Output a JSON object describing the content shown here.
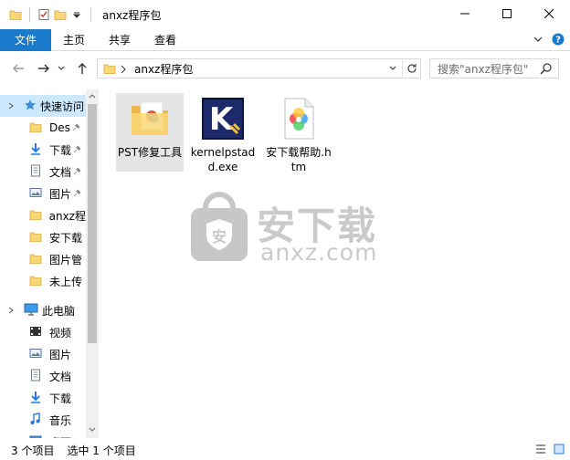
{
  "window": {
    "title": "anxz程序包"
  },
  "ribbon": {
    "tabs": [
      {
        "label": "文件"
      },
      {
        "label": "主页"
      },
      {
        "label": "共享"
      },
      {
        "label": "查看"
      }
    ]
  },
  "address": {
    "path": "anxz程序包",
    "search_placeholder": "搜索\"anxz程序包\""
  },
  "nav": {
    "quick_access": "快速访问",
    "items": [
      {
        "label": "Des",
        "icon": "folder-icon",
        "pinned": true
      },
      {
        "label": "下载",
        "icon": "download-icon",
        "pinned": true
      },
      {
        "label": "文档",
        "icon": "document-icon",
        "pinned": true
      },
      {
        "label": "图片",
        "icon": "picture-icon",
        "pinned": true
      },
      {
        "label": "anxz程",
        "icon": "folder-icon",
        "pinned": false
      },
      {
        "label": "安下载",
        "icon": "folder-icon",
        "pinned": false
      },
      {
        "label": "图片管",
        "icon": "folder-icon",
        "pinned": false
      },
      {
        "label": "未上传",
        "icon": "folder-icon",
        "pinned": false
      }
    ],
    "this_pc": "此电脑",
    "pc_items": [
      {
        "label": "视频",
        "icon": "video-icon"
      },
      {
        "label": "图片",
        "icon": "picture-icon"
      },
      {
        "label": "文档",
        "icon": "document-icon"
      },
      {
        "label": "下载",
        "icon": "download-icon"
      },
      {
        "label": "音乐",
        "icon": "music-icon"
      },
      {
        "label": "桌面",
        "icon": "desktop-icon"
      }
    ]
  },
  "files": [
    {
      "name": "PST修复工具",
      "icon": "folder-icon",
      "selected": true
    },
    {
      "name": "kernelpstadd.exe",
      "icon": "kernel-app-icon",
      "selected": false
    },
    {
      "name": "安下载帮助.htm",
      "icon": "htm-file-icon",
      "selected": false
    }
  ],
  "watermark": {
    "line1": "安下载",
    "line2": "anxz.com"
  },
  "status": {
    "count": "3 个项目",
    "selection": "选中 1 个项目"
  },
  "colors": {
    "accent": "#1979ca",
    "selected_nav": "#cce8ff",
    "folder": "#f8d775"
  }
}
